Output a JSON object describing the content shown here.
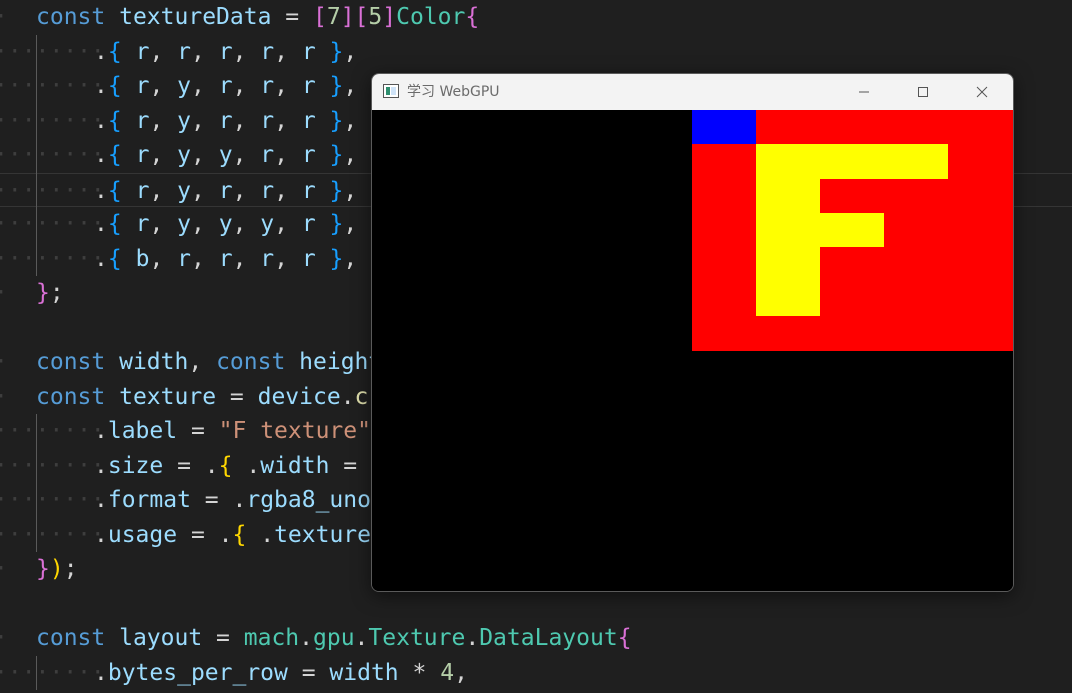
{
  "editor": {
    "lines": [
      {
        "indent": 0,
        "tokens": [
          [
            "kw",
            "const"
          ],
          [
            "op",
            " "
          ],
          [
            "id",
            "textureData"
          ],
          [
            "op",
            " = "
          ],
          [
            "br-p",
            "["
          ],
          [
            "num",
            "7"
          ],
          [
            "br-p",
            "]["
          ],
          [
            "num",
            "5"
          ],
          [
            "br-p",
            "]"
          ],
          [
            "tp",
            "Color"
          ],
          [
            "br-p",
            "{"
          ]
        ]
      },
      {
        "indent": 1,
        "tokens": [
          [
            "op",
            "."
          ],
          [
            "br-b",
            "{"
          ],
          [
            "op",
            " "
          ],
          [
            "id",
            "r"
          ],
          [
            "op",
            ", "
          ],
          [
            "id",
            "r"
          ],
          [
            "op",
            ", "
          ],
          [
            "id",
            "r"
          ],
          [
            "op",
            ", "
          ],
          [
            "id",
            "r"
          ],
          [
            "op",
            ", "
          ],
          [
            "id",
            "r"
          ],
          [
            "op",
            " "
          ],
          [
            "br-b",
            "}"
          ],
          [
            "op",
            ","
          ]
        ]
      },
      {
        "indent": 1,
        "tokens": [
          [
            "op",
            "."
          ],
          [
            "br-b",
            "{"
          ],
          [
            "op",
            " "
          ],
          [
            "id",
            "r"
          ],
          [
            "op",
            ", "
          ],
          [
            "id",
            "y"
          ],
          [
            "op",
            ", "
          ],
          [
            "id",
            "r"
          ],
          [
            "op",
            ", "
          ],
          [
            "id",
            "r"
          ],
          [
            "op",
            ", "
          ],
          [
            "id",
            "r"
          ],
          [
            "op",
            " "
          ],
          [
            "br-b",
            "}"
          ],
          [
            "op",
            ","
          ]
        ]
      },
      {
        "indent": 1,
        "tokens": [
          [
            "op",
            "."
          ],
          [
            "br-b",
            "{"
          ],
          [
            "op",
            " "
          ],
          [
            "id",
            "r"
          ],
          [
            "op",
            ", "
          ],
          [
            "id",
            "y"
          ],
          [
            "op",
            ", "
          ],
          [
            "id",
            "r"
          ],
          [
            "op",
            ", "
          ],
          [
            "id",
            "r"
          ],
          [
            "op",
            ", "
          ],
          [
            "id",
            "r"
          ],
          [
            "op",
            " "
          ],
          [
            "br-b",
            "}"
          ],
          [
            "op",
            ","
          ]
        ]
      },
      {
        "indent": 1,
        "tokens": [
          [
            "op",
            "."
          ],
          [
            "br-b",
            "{"
          ],
          [
            "op",
            " "
          ],
          [
            "id",
            "r"
          ],
          [
            "op",
            ", "
          ],
          [
            "id",
            "y"
          ],
          [
            "op",
            ", "
          ],
          [
            "id",
            "y"
          ],
          [
            "op",
            ", "
          ],
          [
            "id",
            "r"
          ],
          [
            "op",
            ", "
          ],
          [
            "id",
            "r"
          ],
          [
            "op",
            " "
          ],
          [
            "br-b",
            "}"
          ],
          [
            "op",
            ","
          ]
        ]
      },
      {
        "indent": 1,
        "current": true,
        "tokens": [
          [
            "op",
            "."
          ],
          [
            "br-b",
            "{"
          ],
          [
            "op",
            " "
          ],
          [
            "id",
            "r"
          ],
          [
            "op",
            ", "
          ],
          [
            "id",
            "y"
          ],
          [
            "op",
            ", "
          ],
          [
            "id",
            "r"
          ],
          [
            "op",
            ", "
          ],
          [
            "id",
            "r"
          ],
          [
            "op",
            ", "
          ],
          [
            "id",
            "r"
          ],
          [
            "op",
            " "
          ],
          [
            "br-b",
            "}"
          ],
          [
            "op",
            ","
          ]
        ]
      },
      {
        "indent": 1,
        "tokens": [
          [
            "op",
            "."
          ],
          [
            "br-b",
            "{"
          ],
          [
            "op",
            " "
          ],
          [
            "id",
            "r"
          ],
          [
            "op",
            ", "
          ],
          [
            "id",
            "y"
          ],
          [
            "op",
            ", "
          ],
          [
            "id",
            "y"
          ],
          [
            "op",
            ", "
          ],
          [
            "id",
            "y"
          ],
          [
            "op",
            ", "
          ],
          [
            "id",
            "r"
          ],
          [
            "op",
            " "
          ],
          [
            "br-b",
            "}"
          ],
          [
            "op",
            ","
          ]
        ]
      },
      {
        "indent": 1,
        "tokens": [
          [
            "op",
            "."
          ],
          [
            "br-b",
            "{"
          ],
          [
            "op",
            " "
          ],
          [
            "id",
            "b"
          ],
          [
            "op",
            ", "
          ],
          [
            "id",
            "r"
          ],
          [
            "op",
            ", "
          ],
          [
            "id",
            "r"
          ],
          [
            "op",
            ", "
          ],
          [
            "id",
            "r"
          ],
          [
            "op",
            ", "
          ],
          [
            "id",
            "r"
          ],
          [
            "op",
            " "
          ],
          [
            "br-b",
            "}"
          ],
          [
            "op",
            ","
          ]
        ]
      },
      {
        "indent": 0,
        "tokens": [
          [
            "br-p",
            "}"
          ],
          [
            "op",
            ";"
          ]
        ]
      },
      {
        "indent": -1,
        "tokens": []
      },
      {
        "indent": 0,
        "tokens": [
          [
            "kw",
            "const"
          ],
          [
            "op",
            " "
          ],
          [
            "id",
            "width"
          ],
          [
            "op",
            ", "
          ],
          [
            "kw",
            "const"
          ],
          [
            "op",
            " "
          ],
          [
            "id",
            "height"
          ]
        ]
      },
      {
        "indent": 0,
        "tokens": [
          [
            "kw",
            "const"
          ],
          [
            "op",
            " "
          ],
          [
            "id",
            "texture"
          ],
          [
            "op",
            " = "
          ],
          [
            "id",
            "device"
          ],
          [
            "op",
            "."
          ],
          [
            "fn",
            "c"
          ]
        ]
      },
      {
        "indent": 1,
        "tokens": [
          [
            "op",
            "."
          ],
          [
            "id",
            "label"
          ],
          [
            "op",
            " = "
          ],
          [
            "str",
            "\"F texture\""
          ]
        ]
      },
      {
        "indent": 1,
        "tokens": [
          [
            "op",
            "."
          ],
          [
            "id",
            "size"
          ],
          [
            "op",
            " = ."
          ],
          [
            "br-y",
            "{"
          ],
          [
            "op",
            " ."
          ],
          [
            "id",
            "width"
          ],
          [
            "op",
            " = "
          ]
        ]
      },
      {
        "indent": 1,
        "tokens": [
          [
            "op",
            "."
          ],
          [
            "id",
            "format"
          ],
          [
            "op",
            " = ."
          ],
          [
            "id",
            "rgba8_uno"
          ]
        ]
      },
      {
        "indent": 1,
        "tokens": [
          [
            "op",
            "."
          ],
          [
            "id",
            "usage"
          ],
          [
            "op",
            " = ."
          ],
          [
            "br-y",
            "{"
          ],
          [
            "op",
            " ."
          ],
          [
            "id",
            "texture"
          ]
        ]
      },
      {
        "indent": 0,
        "tokens": [
          [
            "br-p",
            "}"
          ],
          [
            "br-y",
            ")"
          ],
          [
            "op",
            ";"
          ]
        ]
      },
      {
        "indent": -1,
        "tokens": []
      },
      {
        "indent": 0,
        "tokens": [
          [
            "kw",
            "const"
          ],
          [
            "op",
            " "
          ],
          [
            "id",
            "layout"
          ],
          [
            "op",
            " = "
          ],
          [
            "tp",
            "mach"
          ],
          [
            "op",
            "."
          ],
          [
            "tp",
            "gpu"
          ],
          [
            "op",
            "."
          ],
          [
            "tp",
            "Texture"
          ],
          [
            "op",
            "."
          ],
          [
            "tp",
            "DataLayout"
          ],
          [
            "br-p",
            "{"
          ]
        ]
      },
      {
        "indent": 1,
        "tokens": [
          [
            "op",
            "."
          ],
          [
            "id",
            "bytes_per_row"
          ],
          [
            "op",
            " = "
          ],
          [
            "id",
            "width"
          ],
          [
            "op",
            " * "
          ],
          [
            "num",
            "4"
          ],
          [
            "op",
            ","
          ]
        ]
      }
    ]
  },
  "window": {
    "title": "学习 WebGPU",
    "minimize_icon": "minimize-icon",
    "maximize_icon": "maximize-icon",
    "close_icon": "close-icon"
  },
  "texture": {
    "colors": {
      "r": "#ff0000",
      "y": "#ffff00",
      "b": "#0000ff"
    },
    "rows": [
      [
        "b",
        "r",
        "r",
        "r",
        "r"
      ],
      [
        "r",
        "y",
        "y",
        "y",
        "r"
      ],
      [
        "r",
        "y",
        "r",
        "r",
        "r"
      ],
      [
        "r",
        "y",
        "y",
        "r",
        "r"
      ],
      [
        "r",
        "y",
        "r",
        "r",
        "r"
      ],
      [
        "r",
        "y",
        "r",
        "r",
        "r"
      ],
      [
        "r",
        "r",
        "r",
        "r",
        "r"
      ]
    ]
  }
}
